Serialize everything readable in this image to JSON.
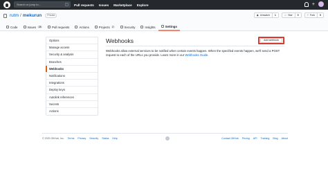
{
  "header": {
    "search_placeholder": "Search or jump to...",
    "search_kbd": "/",
    "nav": [
      "Pull requests",
      "Issues",
      "Marketplace",
      "Explore"
    ]
  },
  "repo": {
    "owner": "rutm",
    "separator": "/",
    "name": "mekurun",
    "visibility": "Private",
    "actions": [
      {
        "label": "Unwatch",
        "count": "1"
      },
      {
        "label": "Star",
        "count": "0"
      },
      {
        "label": "Fork",
        "count": "0"
      }
    ],
    "tabs": [
      {
        "label": "Code",
        "icon": "code-icon"
      },
      {
        "label": "Issues",
        "icon": "issue-icon",
        "counter": "28"
      },
      {
        "label": "Pull requests",
        "icon": "pull-request-icon"
      },
      {
        "label": "Actions",
        "icon": "play-icon"
      },
      {
        "label": "Projects",
        "icon": "project-icon",
        "counter": "2"
      },
      {
        "label": "Security",
        "icon": "shield-icon"
      },
      {
        "label": "Insights",
        "icon": "graph-icon"
      },
      {
        "label": "Settings",
        "icon": "gear-icon",
        "active": true
      }
    ]
  },
  "sidebar": {
    "items": [
      "Options",
      "Manage access",
      "Security & analysis",
      "Branches",
      "Webhooks",
      "Notifications",
      "Integrations",
      "Deploy keys",
      "Autolink references",
      "Secrets",
      "Actions"
    ],
    "selected_index": 4
  },
  "main": {
    "title": "Webhooks",
    "add_button": "Add webhook",
    "description_before_link": "Webhooks allow external services to be notified when certain events happen. When the specified events happen, we'll send a POST request to each of the URLs you provide. Learn more in our ",
    "description_link": "Webhooks Guide",
    "description_after_link": "."
  },
  "footer": {
    "copyright": "© 2020 GitHub, Inc.",
    "left_links": [
      "Terms",
      "Privacy",
      "Security",
      "Status",
      "Help"
    ],
    "right_links": [
      "Contact GitHub",
      "Pricing",
      "API",
      "Training",
      "Blog",
      "About"
    ]
  },
  "colors": {
    "header_bg": "#24292e",
    "link": "#0366d6",
    "active_tab_underline": "#f9826c",
    "highlight_box": "#d73a2e"
  }
}
